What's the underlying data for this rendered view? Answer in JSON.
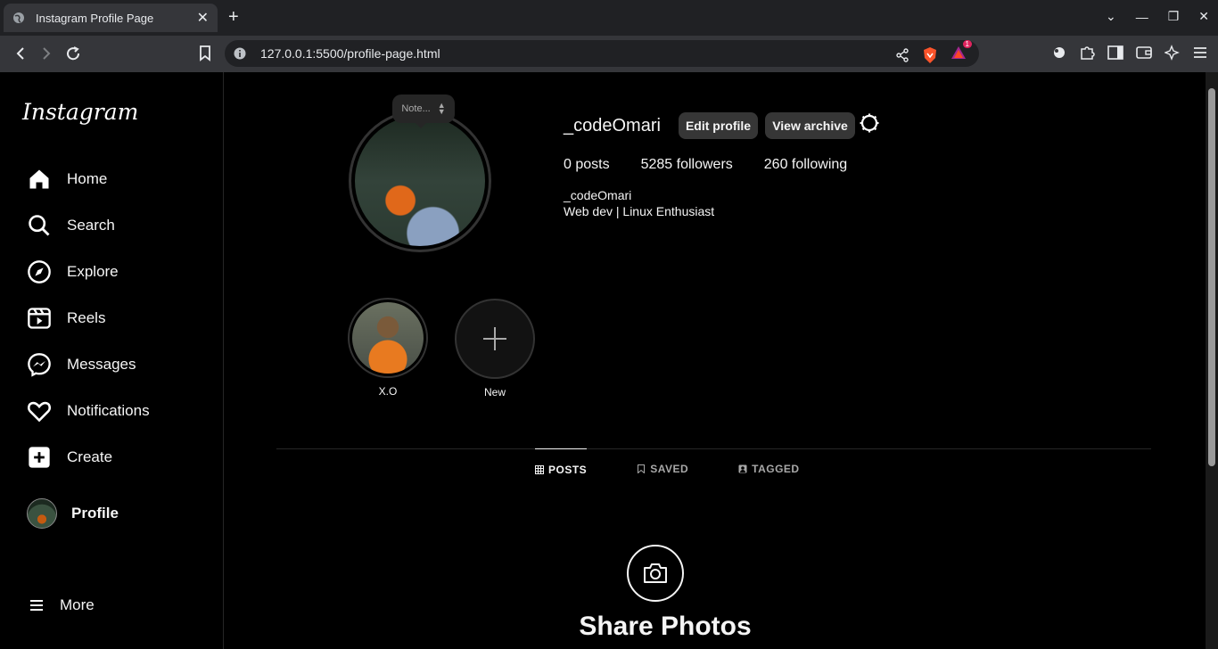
{
  "browser": {
    "tab_title": "Instagram Profile Page",
    "url": "127.0.0.1:5500/profile-page.html",
    "notification_count": "1"
  },
  "sidebar": {
    "logo": "Instagram",
    "items": [
      {
        "label": "Home",
        "icon": "home-icon"
      },
      {
        "label": "Search",
        "icon": "search-icon"
      },
      {
        "label": "Explore",
        "icon": "compass-icon"
      },
      {
        "label": "Reels",
        "icon": "reels-icon"
      },
      {
        "label": "Messages",
        "icon": "messenger-icon"
      },
      {
        "label": "Notifications",
        "icon": "heart-icon"
      },
      {
        "label": "Create",
        "icon": "plus-square-icon"
      },
      {
        "label": "Profile",
        "icon": "avatar"
      }
    ],
    "more_label": "More"
  },
  "profile": {
    "note_placeholder": "Note...",
    "username": "_codeOmari",
    "edit_label": "Edit profile",
    "archive_label": "View archive",
    "posts": "0 posts",
    "followers": "5285 followers",
    "following": "260 following",
    "bio_name": "_codeOmari",
    "bio_text": "Web dev | Linux Enthusiast"
  },
  "highlights": [
    {
      "label": "X.O"
    },
    {
      "label": "New"
    }
  ],
  "tabs": [
    {
      "label": "POSTS",
      "active": true
    },
    {
      "label": "SAVED",
      "active": false
    },
    {
      "label": "TAGGED",
      "active": false
    }
  ],
  "empty": {
    "title": "Share Photos"
  }
}
